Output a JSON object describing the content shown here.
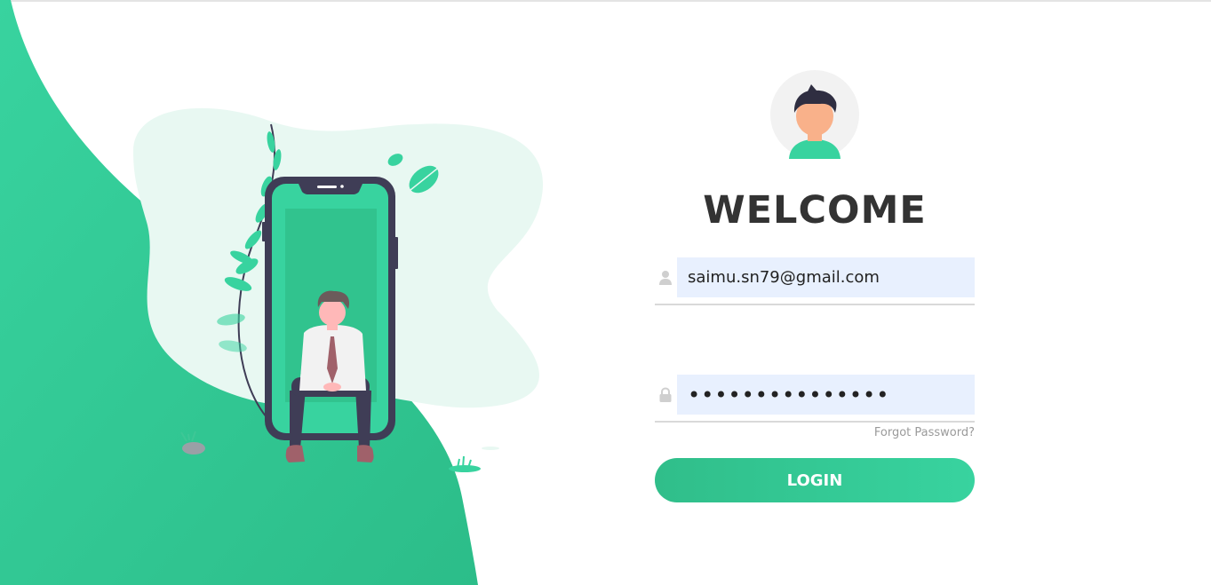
{
  "login": {
    "title": "WELCOME",
    "email_value": "saimu.sn79@gmail.com",
    "email_icon": "user-icon",
    "password_value": "•••••••••••••••",
    "password_icon": "lock-icon",
    "forgot_label": "Forgot Password?",
    "login_label": "LOGIN"
  },
  "colors": {
    "accent": "#38d39f",
    "accent_dark": "#2fbf8a",
    "title": "#333333",
    "input_bg": "#e8f0fe",
    "muted": "#9a9a9a"
  }
}
